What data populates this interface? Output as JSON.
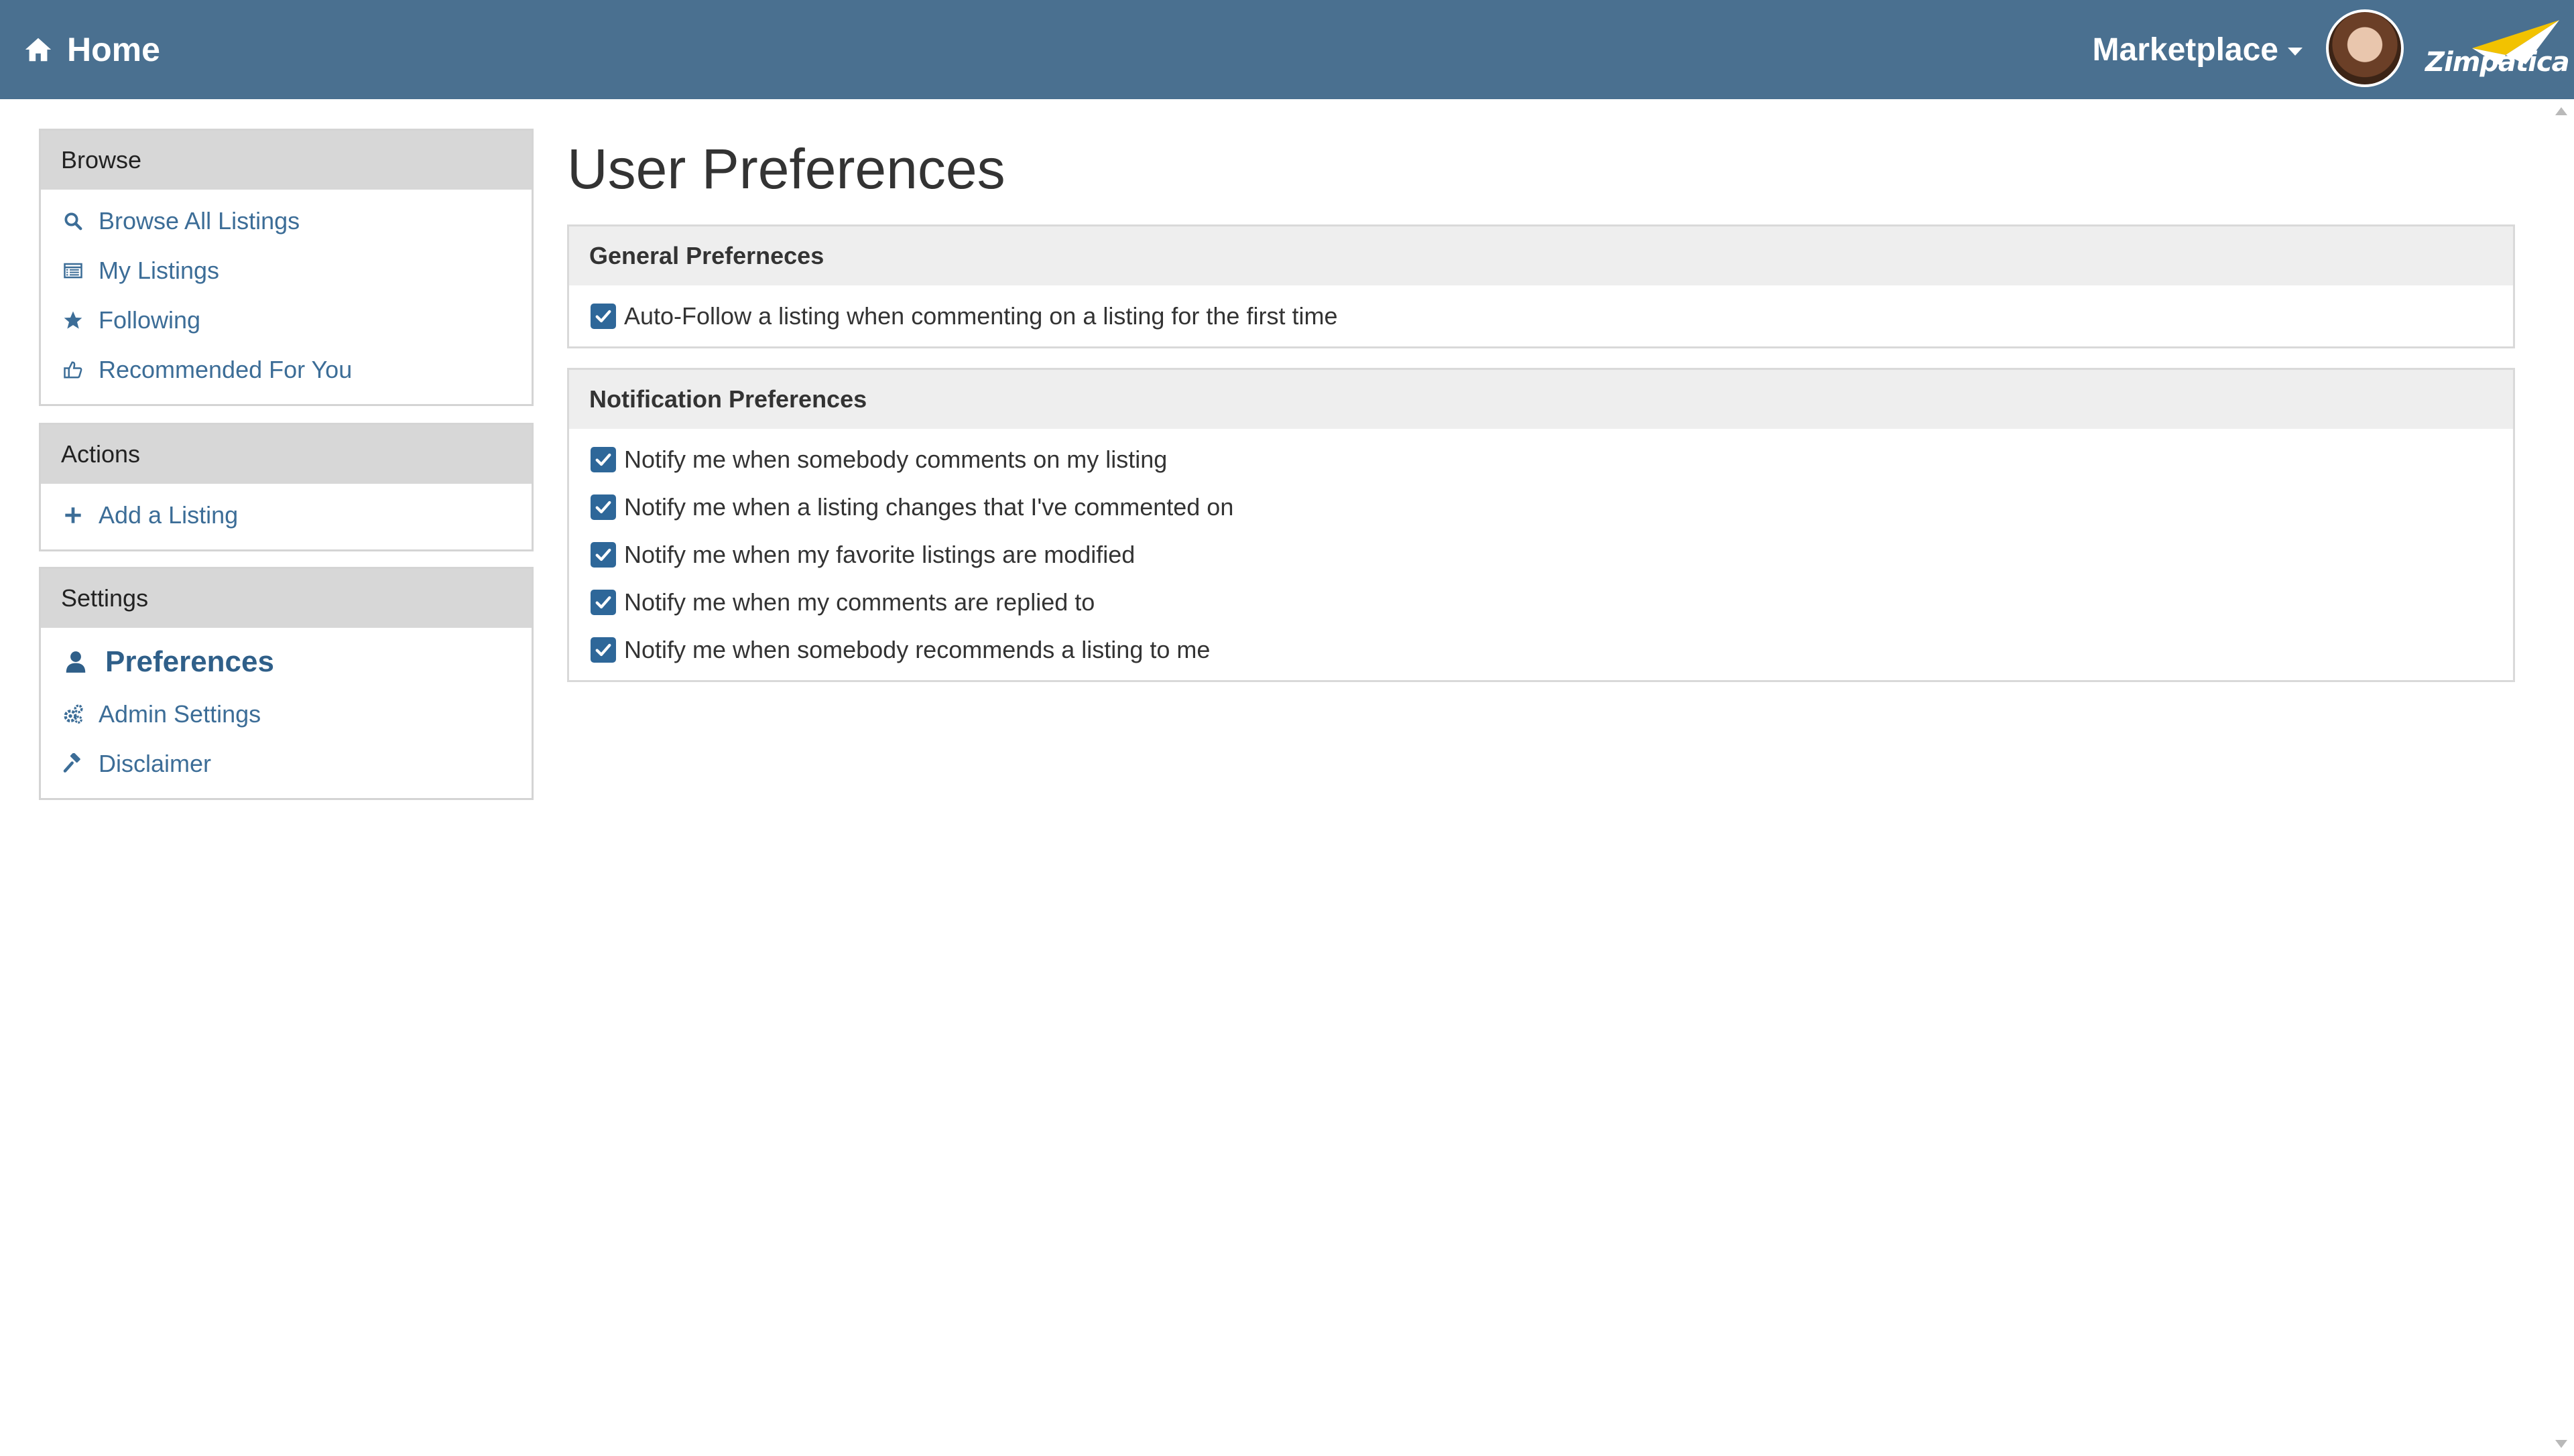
{
  "header": {
    "home_label": "Home",
    "marketplace_label": "Marketplace",
    "logo_text": "Zimpatica",
    "brand_color": "#4a7090"
  },
  "sidebar": {
    "browse": {
      "title": "Browse",
      "items": [
        {
          "label": "Browse All Listings",
          "icon": "search-icon"
        },
        {
          "label": "My Listings",
          "icon": "list-icon"
        },
        {
          "label": "Following",
          "icon": "star-icon"
        },
        {
          "label": "Recommended For You",
          "icon": "thumbs-up-icon"
        }
      ]
    },
    "actions": {
      "title": "Actions",
      "items": [
        {
          "label": "Add a Listing",
          "icon": "plus-icon"
        }
      ]
    },
    "settings": {
      "title": "Settings",
      "items": [
        {
          "label": "Preferences",
          "icon": "user-icon",
          "active": true
        },
        {
          "label": "Admin Settings",
          "icon": "gears-icon"
        },
        {
          "label": "Disclaimer",
          "icon": "gavel-icon"
        }
      ]
    }
  },
  "main": {
    "title": "User Preferences",
    "general": {
      "title": "General Preferneces",
      "options": [
        {
          "label": "Auto-Follow a listing when commenting on a listing for the first time",
          "checked": true
        }
      ]
    },
    "notifications": {
      "title": "Notification Preferences",
      "options": [
        {
          "label": "Notify me when somebody comments on my listing",
          "checked": true
        },
        {
          "label": "Notify me when a listing changes that I've commented on",
          "checked": true
        },
        {
          "label": "Notify me when my favorite listings are modified",
          "checked": true
        },
        {
          "label": "Notify me when my comments are replied to",
          "checked": true
        },
        {
          "label": "Notify me when somebody recommends a listing to me",
          "checked": true
        }
      ]
    }
  },
  "colors": {
    "link": "#3c6d97",
    "checkbox": "#2e6799",
    "panel_header": "#d7d7d7",
    "card_header": "#eeeeee"
  }
}
